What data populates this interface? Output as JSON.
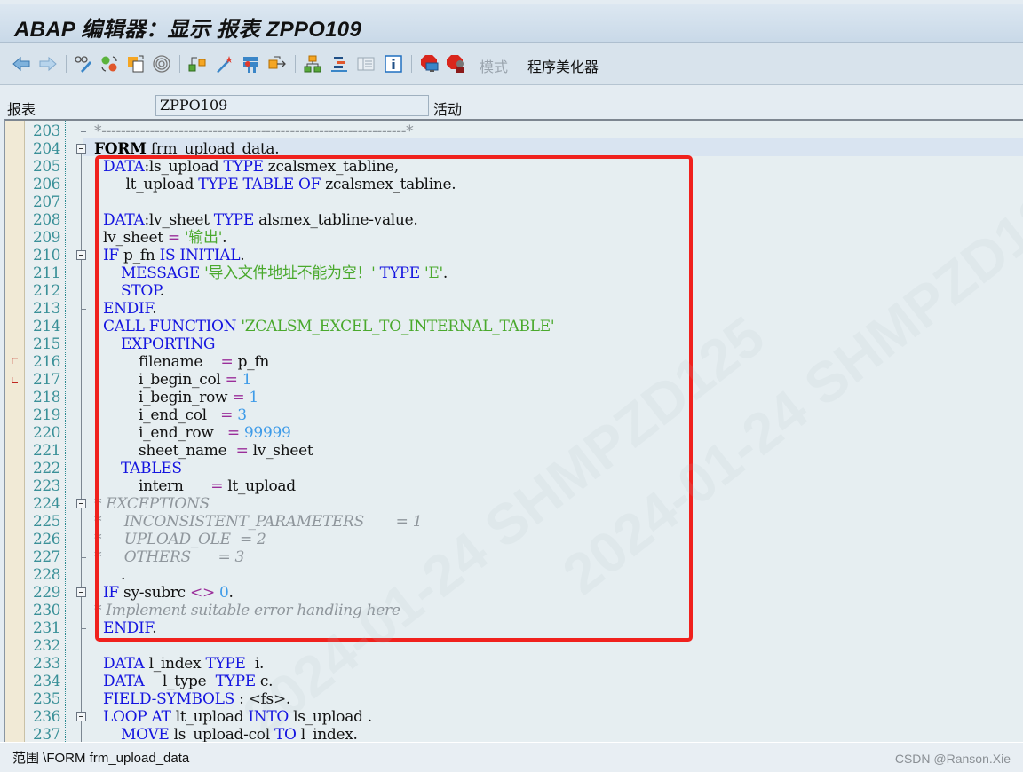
{
  "window": {
    "title": "ABAP 编辑器：显示 报表 ZPPO109"
  },
  "toolbar": {
    "buttons": [
      {
        "name": "back-icon"
      },
      {
        "name": "forward-icon"
      },
      {
        "name": "display-change-icon"
      },
      {
        "name": "active-inactive-icon"
      },
      {
        "name": "other-object-icon"
      },
      {
        "name": "where-used-icon"
      },
      {
        "name": "check-icon"
      },
      {
        "name": "activate-icon"
      },
      {
        "name": "test-icon"
      },
      {
        "name": "where-used-list-icon"
      },
      {
        "name": "object-list-icon"
      },
      {
        "name": "navigation-window-icon"
      },
      {
        "name": "layout-icon"
      },
      {
        "name": "info-icon"
      },
      {
        "name": "set-breakpoint-icon"
      },
      {
        "name": "session-breakpoint-icon"
      }
    ],
    "pattern_label": "模式",
    "pretty_printer_label": "程序美化器"
  },
  "fields": {
    "report_label": "报表",
    "report_value": "ZPPO109",
    "status": "活动"
  },
  "editor": {
    "lines": [
      {
        "no": "203",
        "code": "comment_sep"
      },
      {
        "no": "204"
      },
      {
        "no": "205"
      },
      {
        "no": "206"
      },
      {
        "no": "207"
      },
      {
        "no": "208"
      },
      {
        "no": "209"
      },
      {
        "no": "210"
      },
      {
        "no": "211"
      },
      {
        "no": "212"
      },
      {
        "no": "213"
      },
      {
        "no": "214"
      },
      {
        "no": "215"
      },
      {
        "no": "216"
      },
      {
        "no": "217"
      },
      {
        "no": "218"
      },
      {
        "no": "219"
      },
      {
        "no": "220"
      },
      {
        "no": "221"
      },
      {
        "no": "222"
      },
      {
        "no": "223"
      },
      {
        "no": "224"
      },
      {
        "no": "225"
      },
      {
        "no": "226"
      },
      {
        "no": "227"
      },
      {
        "no": "228"
      },
      {
        "no": "229"
      },
      {
        "no": "230"
      },
      {
        "no": "231"
      },
      {
        "no": "232"
      },
      {
        "no": "233"
      },
      {
        "no": "234"
      },
      {
        "no": "235"
      },
      {
        "no": "236"
      },
      {
        "no": "237"
      }
    ],
    "tokens": {
      "l203": "*---------------------------------------------------------------*",
      "l204_kw": "FORM",
      "l204_rest": " frm_upload_data.",
      "l205_kw1": "DATA",
      "l205_a": ":ls_upload ",
      "l205_kw2": "TYPE",
      "l205_b": " zcalsmex_tabline,",
      "l206_a": "     lt_upload ",
      "l206_kw1": "TYPE TABLE OF",
      "l206_b": " zcalsmex_tabline.",
      "l208_kw1": "DATA",
      "l208_a": ":lv_sheet ",
      "l208_kw2": "TYPE",
      "l208_b": " alsmex_tabline-value.",
      "l209_a": "lv_sheet ",
      "l209_op": "=",
      "l209_str": " '输出'",
      "l209_b": ".",
      "l210_kw1": "IF",
      "l210_a": " p_fn ",
      "l210_kw2": "IS INITIAL",
      "l210_b": ".",
      "l211_kw1": "MESSAGE",
      "l211_str": " '导入文件地址不能为空！'",
      "l211_kw2": " TYPE",
      "l211_str2": " 'E'",
      "l211_b": ".",
      "l212_kw": "STOP",
      "l212_b": ".",
      "l213_kw": "ENDIF",
      "l213_b": ".",
      "l214_kw": "CALL FUNCTION",
      "l214_str": " 'ZCALSM_EXCEL_TO_INTERNAL_TABLE'",
      "l215_kw": "EXPORTING",
      "l216_a": "filename    ",
      "l216_op": "=",
      "l216_b": " p_fn",
      "l217_a": "i_begin_col ",
      "l217_op": "=",
      "l217_num": " 1",
      "l218_a": "i_begin_row ",
      "l218_op": "=",
      "l218_num": " 1",
      "l219_a": "i_end_col   ",
      "l219_op": "=",
      "l219_num": " 3",
      "l220_a": "i_end_row   ",
      "l220_op": "=",
      "l220_num": " 99999",
      "l221_a": "sheet_name  ",
      "l221_op": "=",
      "l221_b": " lv_sheet",
      "l222_kw": "TABLES",
      "l223_a": "intern      ",
      "l223_op": "=",
      "l223_b": " lt_upload",
      "l224": "* EXCEPTIONS",
      "l225": "*     INCONSISTENT_PARAMETERS       = 1",
      "l226": "*     UPLOAD_OLE  = 2",
      "l227": "*     OTHERS      = 3",
      "l228": ".",
      "l229_kw": "IF",
      "l229_a": " sy-subrc ",
      "l229_op": "<>",
      "l229_num": " 0",
      "l229_b": ".",
      "l230": "* Implement suitable error handling here",
      "l231_kw": "ENDIF",
      "l231_b": ".",
      "l233_kw1": "DATA",
      "l233_a": " l_index ",
      "l233_kw2": "TYPE",
      "l233_b": "  i.",
      "l234_kw1": "DATA",
      "l234_a": "    l_type  ",
      "l234_kw2": "TYPE",
      "l234_b": " c.",
      "l235_kw": "FIELD-SYMBOLS",
      "l235_a": " : <fs>.",
      "l236_kw1": "LOOP AT",
      "l236_a": " lt_upload ",
      "l236_kw2": "INTO",
      "l236_b": " ls_upload .",
      "l237_kw1": "MOVE",
      "l237_a": " ls_upload-col ",
      "l237_kw2": "TO",
      "l237_b": " l_index."
    }
  },
  "statusbar": {
    "scope_label": "范围 \\FORM frm_upload_data",
    "watermark": "CSDN @Ranson.Xie"
  },
  "overlay": {
    "watermark_text": "2024-01-24 SHMPZD125",
    "highlight_color": "#f0211d"
  }
}
